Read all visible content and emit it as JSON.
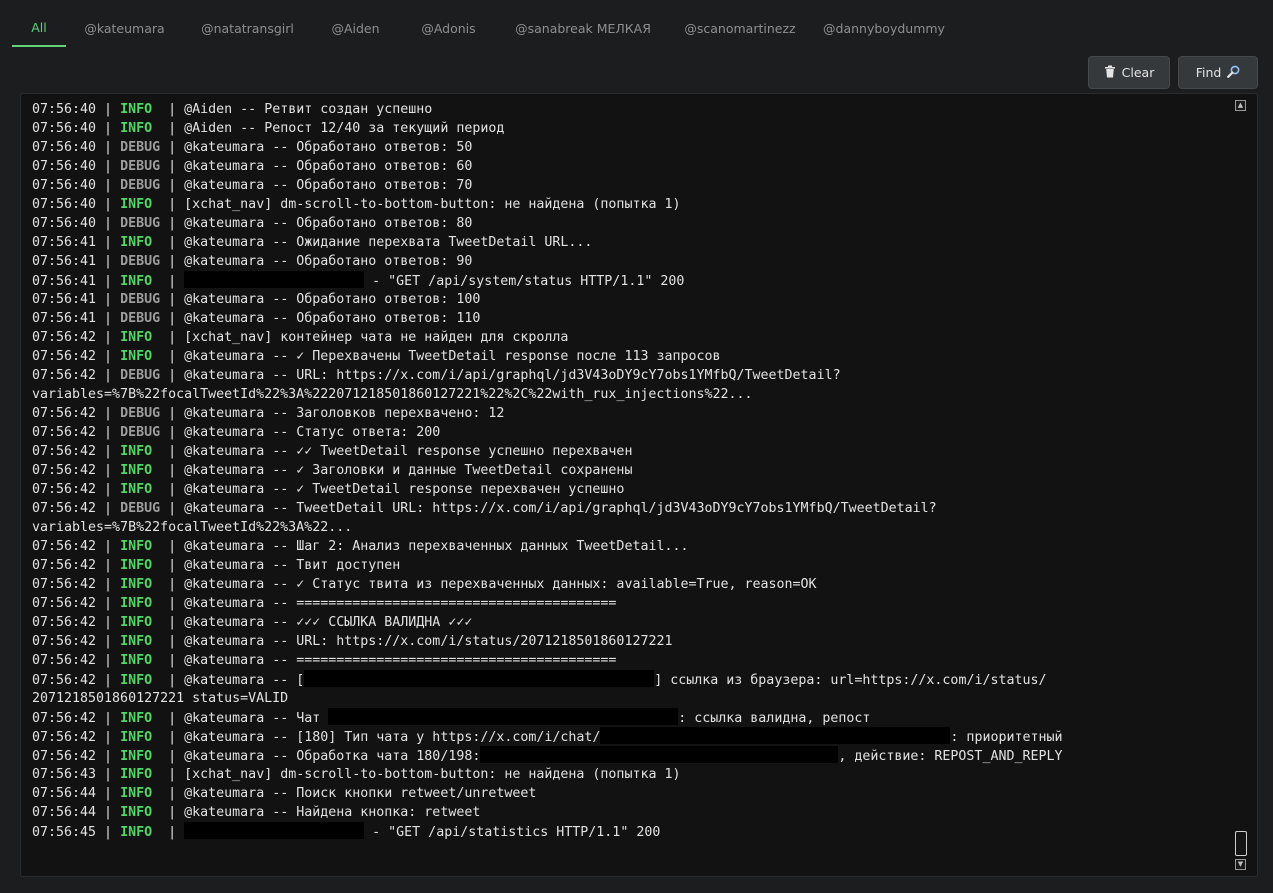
{
  "tabs": [
    "All",
    "@kateumara",
    "@natatransgirl",
    "@Aiden",
    "@Adonis",
    "@sanabreak МЕЛКАЯ",
    "@scanomartinezz",
    "@dannyboydummy"
  ],
  "buttons": {
    "clear": "Clear",
    "find": "Find"
  },
  "icons": {
    "clear": "trash-icon",
    "find": "search-icon"
  },
  "colors": {
    "active_tab": "#5fd27a",
    "info": "#4fd862",
    "debug": "#9d9d9d",
    "background": "#121212"
  },
  "log": [
    {
      "t": "07:56:40",
      "l": "INFO",
      "parts": [
        {
          "text": "@Aiden -- Ретвит создан успешно"
        }
      ]
    },
    {
      "t": "07:56:40",
      "l": "INFO",
      "parts": [
        {
          "text": "@Aiden -- Репост 12/40 за текущий период"
        }
      ]
    },
    {
      "t": "07:56:40",
      "l": "DEBUG",
      "parts": [
        {
          "text": "@kateumara -- Обработано ответов: 50"
        }
      ]
    },
    {
      "t": "07:56:40",
      "l": "DEBUG",
      "parts": [
        {
          "text": "@kateumara -- Обработано ответов: 60"
        }
      ]
    },
    {
      "t": "07:56:40",
      "l": "DEBUG",
      "parts": [
        {
          "text": "@kateumara -- Обработано ответов: 70"
        }
      ]
    },
    {
      "t": "07:56:40",
      "l": "INFO",
      "parts": [
        {
          "text": "[xchat_nav] dm-scroll-to-bottom-button: не найдена (попытка 1)"
        }
      ]
    },
    {
      "t": "07:56:40",
      "l": "DEBUG",
      "parts": [
        {
          "text": "@kateumara -- Обработано ответов: 80"
        }
      ]
    },
    {
      "t": "07:56:41",
      "l": "INFO",
      "parts": [
        {
          "text": "@kateumara -- Ожидание перехвата TweetDetail URL..."
        }
      ]
    },
    {
      "t": "07:56:41",
      "l": "DEBUG",
      "parts": [
        {
          "text": "@kateumara -- Обработано ответов: 90"
        }
      ]
    },
    {
      "t": "07:56:41",
      "l": "INFO",
      "parts": [
        {
          "redact": 180
        },
        {
          "text": " - \"GET /api/system/status HTTP/1.1\" 200"
        }
      ]
    },
    {
      "t": "07:56:41",
      "l": "DEBUG",
      "parts": [
        {
          "text": "@kateumara -- Обработано ответов: 100"
        }
      ]
    },
    {
      "t": "07:56:41",
      "l": "DEBUG",
      "parts": [
        {
          "text": "@kateumara -- Обработано ответов: 110"
        }
      ]
    },
    {
      "t": "07:56:42",
      "l": "INFO",
      "parts": [
        {
          "text": "[xchat_nav] контейнер чата не найден для скролла"
        }
      ]
    },
    {
      "t": "07:56:42",
      "l": "INFO",
      "parts": [
        {
          "text": "@kateumara -- ✓ Перехвачены TweetDetail response после 113 запросов"
        }
      ]
    },
    {
      "t": "07:56:42",
      "l": "DEBUG",
      "parts": [
        {
          "text": "@kateumara -- URL: https://x.com/i/api/graphql/jd3V43oDY9cY7obs1YMfbQ/TweetDetail?"
        }
      ]
    },
    {
      "cont": "variables=%7B%22focalTweetId%22%3A%222071218501860127221%22%2C%22with_rux_injections%22..."
    },
    {
      "t": "07:56:42",
      "l": "DEBUG",
      "parts": [
        {
          "text": "@kateumara -- Заголовков перехвачено: 12"
        }
      ]
    },
    {
      "t": "07:56:42",
      "l": "DEBUG",
      "parts": [
        {
          "text": "@kateumara -- Статус ответа: 200"
        }
      ]
    },
    {
      "t": "07:56:42",
      "l": "INFO",
      "parts": [
        {
          "text": "@kateumara -- ✓✓ TweetDetail response успешно перехвачен"
        }
      ]
    },
    {
      "t": "07:56:42",
      "l": "INFO",
      "parts": [
        {
          "text": "@kateumara -- ✓ Заголовки и данные TweetDetail сохранены"
        }
      ]
    },
    {
      "t": "07:56:42",
      "l": "INFO",
      "parts": [
        {
          "text": "@kateumara -- ✓ TweetDetail response перехвачен успешно"
        }
      ]
    },
    {
      "t": "07:56:42",
      "l": "DEBUG",
      "parts": [
        {
          "text": "@kateumara -- TweetDetail URL: https://x.com/i/api/graphql/jd3V43oDY9cY7obs1YMfbQ/TweetDetail?"
        }
      ]
    },
    {
      "cont": "variables=%7B%22focalTweetId%22%3A%22..."
    },
    {
      "t": "07:56:42",
      "l": "INFO",
      "parts": [
        {
          "text": "@kateumara -- Шаг 2: Анализ перехваченных данных TweetDetail..."
        }
      ]
    },
    {
      "t": "07:56:42",
      "l": "INFO",
      "parts": [
        {
          "text": "@kateumara -- Твит доступен"
        }
      ]
    },
    {
      "t": "07:56:42",
      "l": "INFO",
      "parts": [
        {
          "text": "@kateumara -- ✓ Статус твита из перехваченных данных: available=True, reason=OK"
        }
      ]
    },
    {
      "t": "07:56:42",
      "l": "INFO",
      "parts": [
        {
          "text": "@kateumara -- ========================================"
        }
      ]
    },
    {
      "t": "07:56:42",
      "l": "INFO",
      "parts": [
        {
          "text": "@kateumara -- ✓✓✓ ССЫЛКА ВАЛИДНА ✓✓✓"
        }
      ]
    },
    {
      "t": "07:56:42",
      "l": "INFO",
      "parts": [
        {
          "text": "@kateumara -- URL: https://x.com/i/status/2071218501860127221"
        }
      ]
    },
    {
      "t": "07:56:42",
      "l": "INFO",
      "parts": [
        {
          "text": "@kateumara -- ========================================"
        }
      ]
    },
    {
      "t": "07:56:42",
      "l": "INFO",
      "parts": [
        {
          "text": "@kateumara -- ["
        },
        {
          "redact": 350
        },
        {
          "text": "] ссылка из браузера: url=https://x.com/i/status/"
        }
      ]
    },
    {
      "cont": "2071218501860127221 status=VALID"
    },
    {
      "t": "07:56:42",
      "l": "INFO",
      "parts": [
        {
          "text": "@kateumara -- Чат "
        },
        {
          "redact": 350
        },
        {
          "text": ": ссылка валидна, репост"
        }
      ]
    },
    {
      "t": "07:56:42",
      "l": "INFO",
      "parts": [
        {
          "text": "@kateumara -- [180] Тип чата у https://x.com/i/chat/"
        },
        {
          "redact": 350
        },
        {
          "text": ": приоритетный"
        }
      ]
    },
    {
      "t": "07:56:42",
      "l": "INFO",
      "parts": [
        {
          "text": "@kateumara -- Обработка чата 180/198:"
        },
        {
          "redact": 358
        },
        {
          "text": ", действие: REPOST_AND_REPLY"
        }
      ]
    },
    {
      "t": "07:56:43",
      "l": "INFO",
      "parts": [
        {
          "text": "[xchat_nav] dm-scroll-to-bottom-button: не найдена (попытка 1)"
        }
      ]
    },
    {
      "t": "07:56:44",
      "l": "INFO",
      "parts": [
        {
          "text": "@kateumara -- Поиск кнопки retweet/unretweet"
        }
      ]
    },
    {
      "t": "07:56:44",
      "l": "INFO",
      "parts": [
        {
          "text": "@kateumara -- Найдена кнопка: retweet"
        }
      ]
    },
    {
      "t": "07:56:45",
      "l": "INFO",
      "parts": [
        {
          "redact": 180
        },
        {
          "text": " - \"GET /api/statistics HTTP/1.1\" 200"
        }
      ]
    }
  ]
}
